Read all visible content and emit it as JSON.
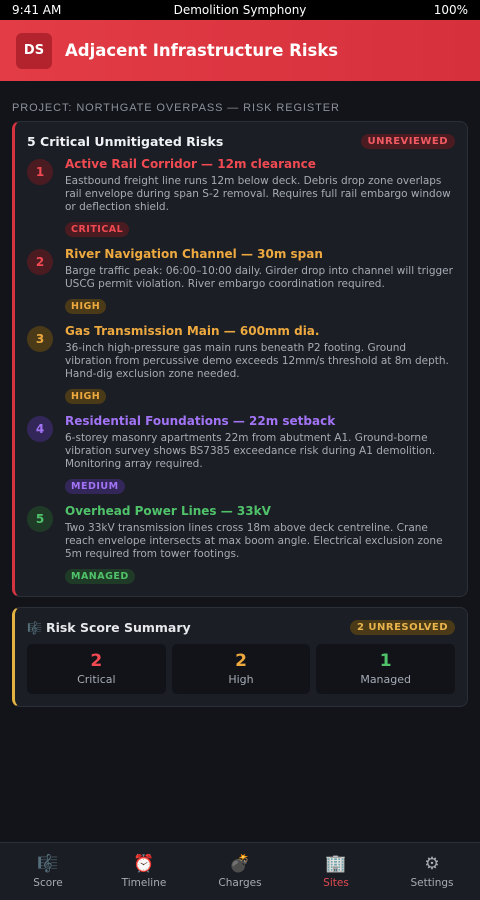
{
  "status": {
    "time": "9:41 AM",
    "title": "Demolition Symphony",
    "battery": "100%"
  },
  "header": {
    "badge": "DS",
    "title": "Adjacent Infrastructure Risks"
  },
  "project_label": "PROJECT: NORTHGATE OVERPASS — RISK REGISTER",
  "risk_card": {
    "title": "5 Critical Unmitigated Risks",
    "badge": "UNREVIEWED",
    "risks": [
      {
        "num": "1",
        "title": "Active Rail Corridor — 12m clearance",
        "desc": "Eastbound freight line runs 12m below deck. Debris drop zone overlaps rail envelope during span S-2 removal. Requires full rail embargo window or deflection shield.",
        "tag": "CRITICAL",
        "color": "#f14a52",
        "num_bg": "#4a1c22",
        "tag_bg": "#4a1c22"
      },
      {
        "num": "2",
        "title": "River Navigation Channel — 30m span",
        "desc": "Barge traffic peak: 06:00–10:00 daily. Girder drop into channel will trigger USCG permit violation. River embargo coordination required.",
        "tag": "HIGH",
        "color": "#eda93f",
        "num_bg": "#4a1c22",
        "tag_bg": "#4a3a17",
        "num_color": "#f14a52"
      },
      {
        "num": "3",
        "title": "Gas Transmission Main — 600mm dia.",
        "desc": "36-inch high-pressure gas main runs beneath P2 footing. Ground vibration from percussive demo exceeds 12mm/s threshold at 8m depth. Hand-dig exclusion zone needed.",
        "tag": "HIGH",
        "color": "#eda93f",
        "num_bg": "#4a3a17",
        "tag_bg": "#4a3a17"
      },
      {
        "num": "4",
        "title": "Residential Foundations — 22m setback",
        "desc": "6-storey masonry apartments 22m from abutment A1. Ground-borne vibration survey shows BS7385 exceedance risk during A1 demolition. Monitoring array required.",
        "tag": "MEDIUM",
        "color": "#a274f5",
        "num_bg": "#33275a",
        "tag_bg": "#33275a"
      },
      {
        "num": "5",
        "title": "Overhead Power Lines — 33kV",
        "desc": "Two 33kV transmission lines cross 18m above deck centreline. Crane reach envelope intersects at max boom angle. Electrical exclusion zone 5m required from tower footings.",
        "tag": "MANAGED",
        "color": "#4fc26a",
        "num_bg": "#1f3b27",
        "tag_bg": "#1f3b27"
      }
    ]
  },
  "summary": {
    "icon": "🎼",
    "title": "Risk Score Summary",
    "badge": "2 UNRESOLVED",
    "stats": [
      {
        "value": "2",
        "label": "Critical",
        "color": "#f14a52"
      },
      {
        "value": "2",
        "label": "High",
        "color": "#eda93f"
      },
      {
        "value": "1",
        "label": "Managed",
        "color": "#4fc26a"
      }
    ]
  },
  "tabs": [
    {
      "icon": "🎼",
      "label": "Score",
      "active": false
    },
    {
      "icon": "⏰",
      "label": "Timeline",
      "active": false
    },
    {
      "icon": "💣",
      "label": "Charges",
      "active": false
    },
    {
      "icon": "🏢",
      "label": "Sites",
      "active": true
    },
    {
      "icon": "⚙",
      "label": "Settings",
      "active": false
    }
  ]
}
